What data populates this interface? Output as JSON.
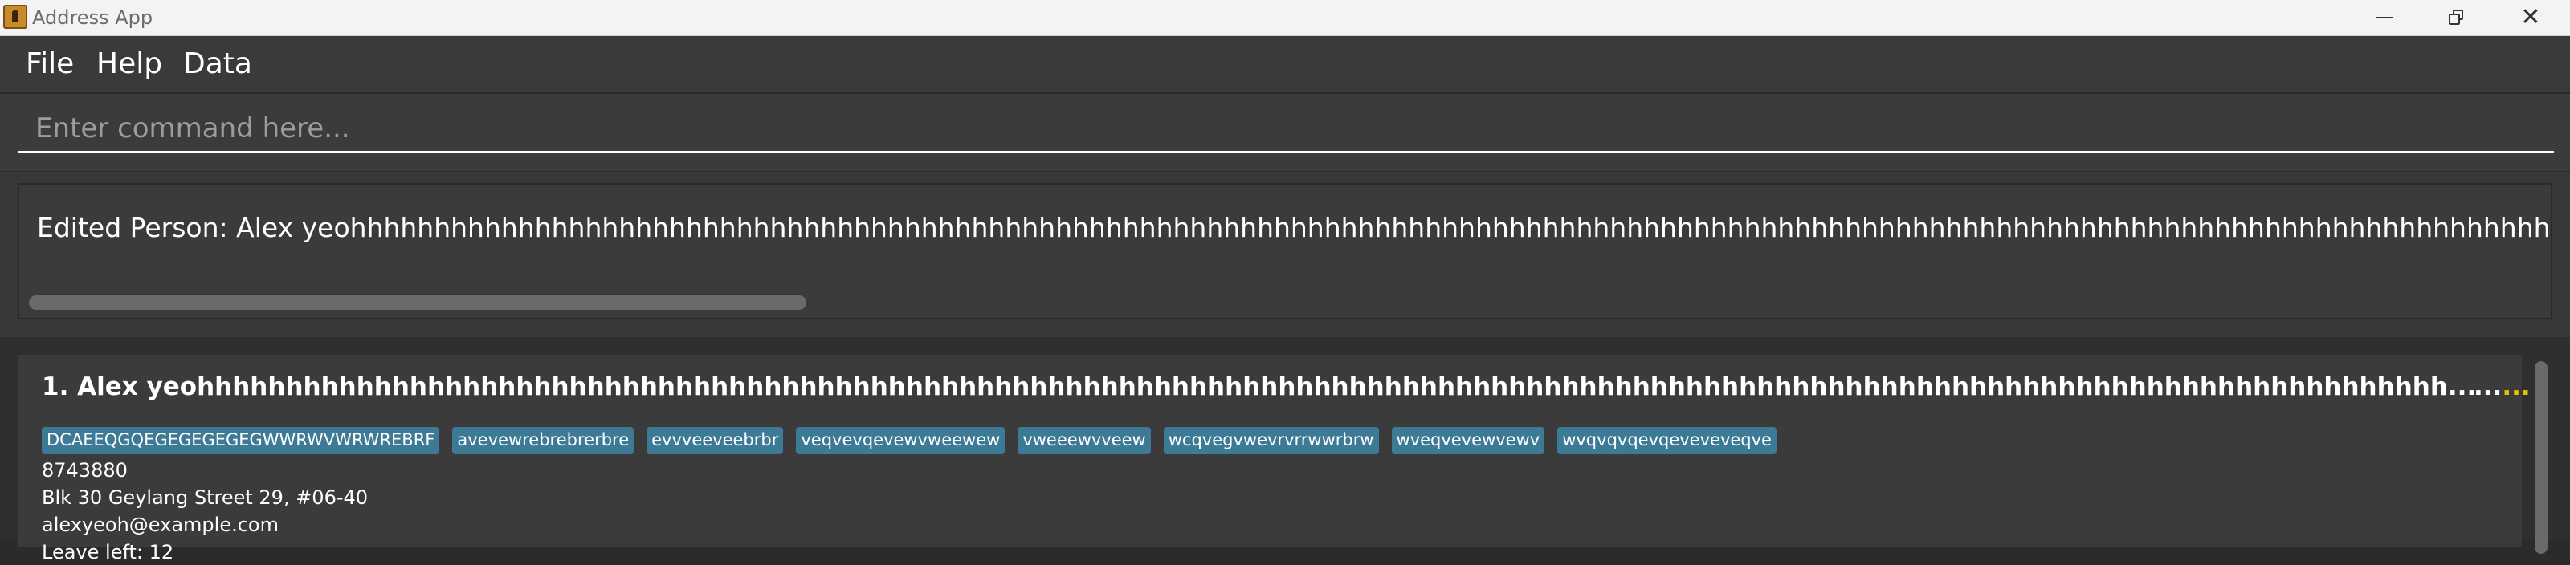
{
  "window": {
    "title": "Address App",
    "minimize_icon": "minimize-icon",
    "restore_icon": "restore-icon",
    "close_glyph": "✕"
  },
  "menu": {
    "items": [
      "File",
      "Help",
      "Data"
    ]
  },
  "command": {
    "placeholder": "Enter command here...",
    "value": ""
  },
  "result": {
    "text": "Edited Person: Alex yeohhhhhhhhhhhhhhhhhhhhhhhhhhhhhhhhhhhhhhhhhhhhhhhhhhhhhhhhhhhhhhhhhhhhhhhhhhhhhhhhhhhhhhhhhhhhhhhhhhhhhhhhhhhhhhhhhhhhhhhhhhhhhhhhhhhhhhhhhhhhhhhhhhhhhhhhhhhhhhhhhhhhhh"
  },
  "persons": [
    {
      "index_name": "1. Alex yeohhhhhhhhhhhhhhhhhhhhhhhhhhhhhhhhhhhhhhhhhhhhhhhhhhhhhhhhhhhhhhhhhhhhhhhhhhhhhhhhhhhhhhhhhhhhhhhhhhhhhhhhhhhhhhhhhhhhhhhhhhhhhhh...",
      "overflow_dots": "...",
      "overflow_dots_accent": "...",
      "tags": [
        "DCAEEQGQEGEGEGEGEGWWRWVWRWREBRF",
        "avevewrebrebrerbre",
        "evvveeveebrbr",
        "veqvevqevewvweewew",
        "vweeewvveew",
        "wcqvegvwevrvrrwwrbrw",
        "wveqvevewvewv",
        "wvqvqvqevqeveveveqve"
      ],
      "phone": "8743880",
      "address": "Blk 30 Geylang Street 29, #06-40",
      "email": "alexyeoh@example.com",
      "leave": "Leave left: 12"
    }
  ],
  "colors": {
    "background": "#2b2b2b",
    "tag": "#3d7a95",
    "accent": "#e8c200"
  }
}
